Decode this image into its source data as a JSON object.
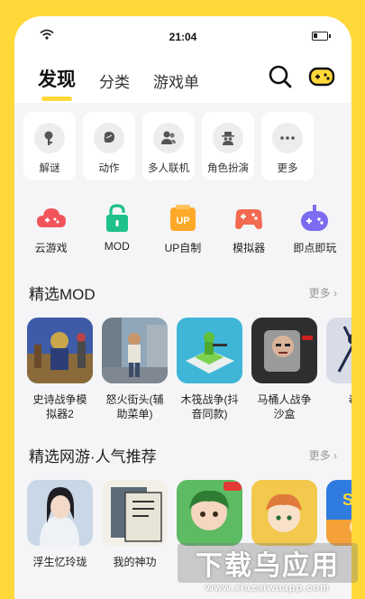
{
  "status": {
    "time": "21:04"
  },
  "tabs": [
    {
      "label": "发现",
      "active": true
    },
    {
      "label": "分类",
      "active": false
    },
    {
      "label": "游戏单",
      "active": false
    }
  ],
  "top_icons": [
    "search-icon",
    "gamepad-icon"
  ],
  "categories": [
    {
      "label": "解谜",
      "icon": "key-icon"
    },
    {
      "label": "动作",
      "icon": "boxing-glove-icon"
    },
    {
      "label": "多人联机",
      "icon": "people-icon"
    },
    {
      "label": "角色扮演",
      "icon": "spy-icon"
    },
    {
      "label": "更多",
      "icon": "more-dots-icon"
    }
  ],
  "functions": [
    {
      "label": "云游戏",
      "icon": "cloud-game-icon",
      "color": "#F2545B"
    },
    {
      "label": "MOD",
      "icon": "lock-icon",
      "color": "#1FC18A"
    },
    {
      "label": "UP自制",
      "icon": "up-badge-icon",
      "color": "#FFA928"
    },
    {
      "label": "模拟器",
      "icon": "controller-icon",
      "color": "#F26A4F"
    },
    {
      "label": "即点即玩",
      "icon": "play-pad-icon",
      "color": "#7B6CF0"
    }
  ],
  "mod_section": {
    "title": "精选MOD",
    "more": "更多",
    "items": [
      {
        "title": "史诗战争模\n拟器2",
        "art": "epic-war"
      },
      {
        "title": "怒火街头(辅\n助菜单)",
        "art": "street"
      },
      {
        "title": "木筏战争(抖\n音同款)",
        "art": "raft"
      },
      {
        "title": "马桶人战争\n沙盒",
        "art": "toilet"
      },
      {
        "title": "毒液\n(最",
        "art": "venom"
      }
    ]
  },
  "online_section": {
    "title": "精选网游·人气推荐",
    "more": "更多",
    "items": [
      {
        "title": "浮生忆玲珑",
        "art": "portrait"
      },
      {
        "title": "我的神功",
        "art": "book"
      },
      {
        "title": "",
        "art": "anime"
      },
      {
        "title": "",
        "art": "anime2"
      },
      {
        "title": "",
        "art": "svs"
      }
    ]
  },
  "watermark": {
    "big": "下载乌应用",
    "small": "www.xiazaiwuapp.com"
  },
  "colors": {
    "accent": "#FFD83A",
    "bg": "#F5F5F7"
  }
}
